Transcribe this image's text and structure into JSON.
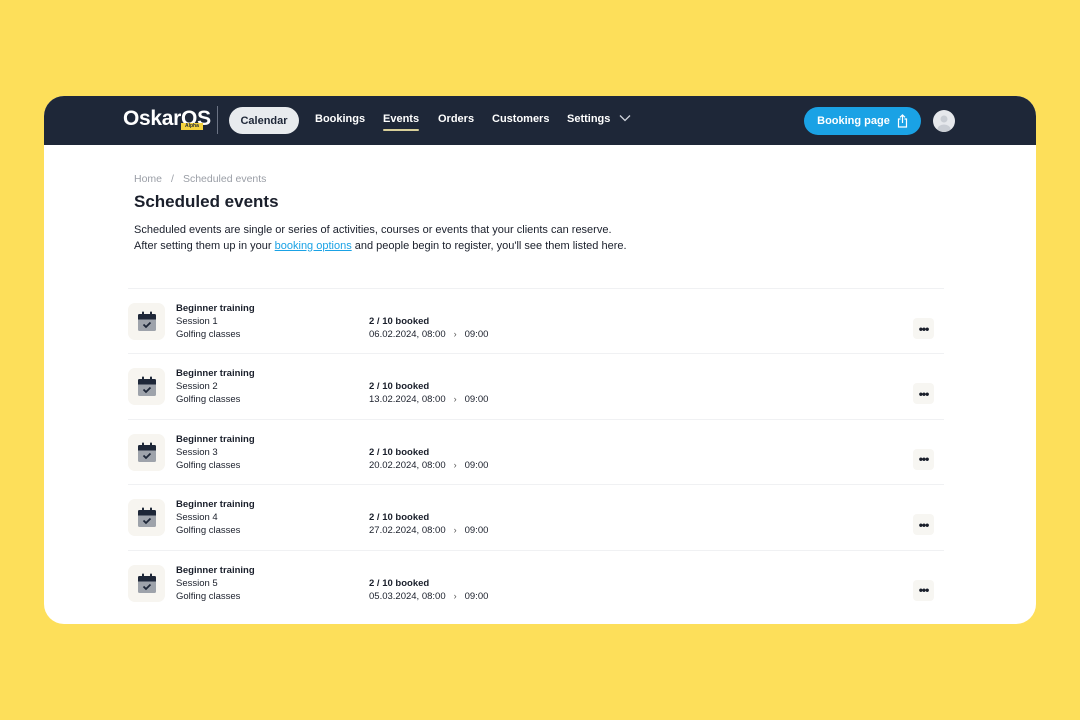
{
  "header": {
    "logo": "OskarOS",
    "logo_badge": "Alpha",
    "nav": {
      "calendar": "Calendar",
      "bookings": "Bookings",
      "events": "Events",
      "orders": "Orders",
      "customers": "Customers",
      "settings": "Settings"
    },
    "active_nav": "Events",
    "booking_page_label": "Booking page"
  },
  "breadcrumb": {
    "home": "Home",
    "separator": "/",
    "current": "Scheduled events"
  },
  "page": {
    "title": "Scheduled events",
    "intro_before_link": "Scheduled events are single or series of activities, courses or events that your clients can reserve. After setting them up in your ",
    "intro_link": "booking options",
    "intro_after_link": " and people begin to register, you'll see them listed here."
  },
  "events": [
    {
      "title": "Beginner training",
      "session": "Session 1",
      "category": "Golfing classes",
      "booked": "2 / 10 booked",
      "start": "06.02.2024, 08:00",
      "end": "09:00"
    },
    {
      "title": "Beginner training",
      "session": "Session 2",
      "category": "Golfing classes",
      "booked": "2 / 10 booked",
      "start": "13.02.2024, 08:00",
      "end": "09:00"
    },
    {
      "title": "Beginner training",
      "session": "Session 3",
      "category": "Golfing classes",
      "booked": "2 / 10 booked",
      "start": "20.02.2024, 08:00",
      "end": "09:00"
    },
    {
      "title": "Beginner training",
      "session": "Session 4",
      "category": "Golfing classes",
      "booked": "2 / 10 booked",
      "start": "27.02.2024, 08:00",
      "end": "09:00"
    },
    {
      "title": "Beginner training",
      "session": "Session 5",
      "category": "Golfing classes",
      "booked": "2 / 10 booked",
      "start": "05.03.2024, 08:00",
      "end": "09:00"
    }
  ],
  "icons": {
    "event": "calendar-check-icon",
    "more": "more-horizontal-icon",
    "arrow": "chevron-right-icon",
    "share": "share-icon",
    "settings_dropdown": "chevron-down-icon"
  },
  "more_glyph": "•••",
  "arrow_glyph": "›",
  "colors": {
    "background": "#fddf5a",
    "topbar": "#1e2738",
    "accent": "#1aa2e5",
    "text": "#1a1f2b",
    "muted": "#9a9ea6"
  }
}
